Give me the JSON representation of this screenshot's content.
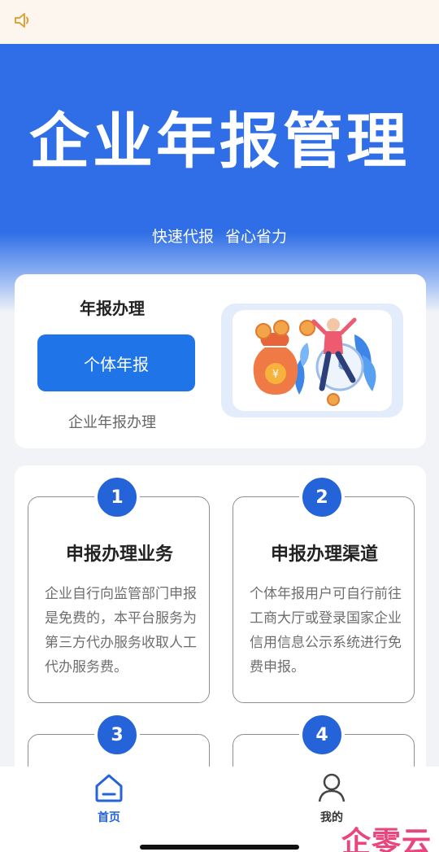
{
  "notice": {
    "icon": "speaker-icon"
  },
  "hero": {
    "title": "企业年报管理",
    "subtitle": "快速代报   省心省力"
  },
  "report_card": {
    "title": "年报办理",
    "button_label": "个体年报",
    "link_label": "企业年报办理",
    "illustration": "money-bag-person-clock-illustration"
  },
  "features": [
    {
      "number": "1",
      "title": "申报办理业务",
      "description": "企业自行向监管部门申报是免费的，本平台服务为第三方代办服务收取人工代办服务费。"
    },
    {
      "number": "2",
      "title": "申报办理渠道",
      "description": "个体年报用户可自行前往 工商大厅或登录国家企业 信用信息公示系统进行免费申报。"
    },
    {
      "number": "3",
      "title": "",
      "description": ""
    },
    {
      "number": "4",
      "title": "",
      "description": ""
    }
  ],
  "tabbar": {
    "tabs": [
      {
        "label": "首页",
        "icon": "home-icon",
        "active": true
      },
      {
        "label": "我的",
        "icon": "user-icon",
        "active": false
      }
    ],
    "watermark": "企零云"
  },
  "colors": {
    "primary": "#2f6ee6",
    "button": "#1f74e8",
    "badge": "#2563d8",
    "watermark": "#e8467c"
  }
}
